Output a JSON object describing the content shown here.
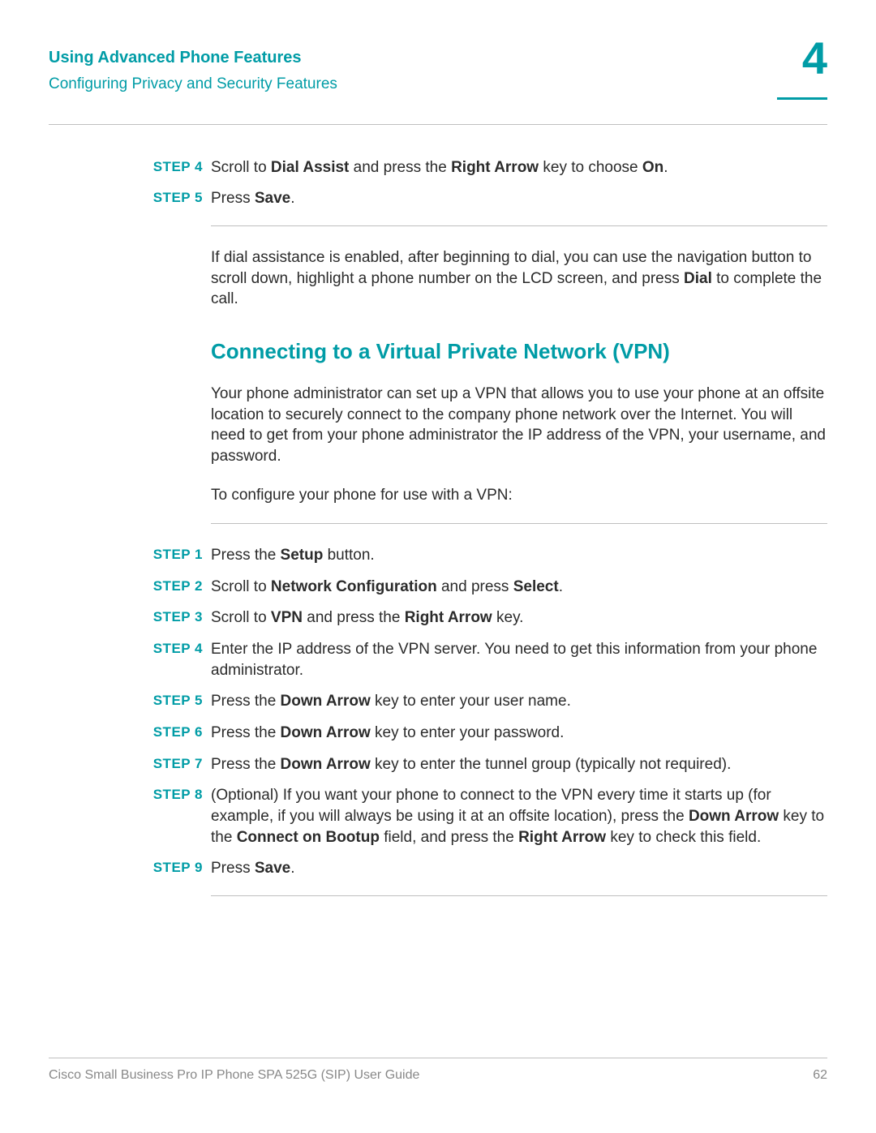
{
  "header": {
    "title": "Using Advanced Phone Features",
    "subtitle": "Configuring Privacy and Security Features",
    "chapter": "4"
  },
  "stepsA": [
    {
      "label": "STEP 4",
      "parts": [
        "Scroll to ",
        "Dial Assist",
        " and press the ",
        "Right Arrow",
        " key to choose ",
        "On",
        "."
      ]
    },
    {
      "label": "STEP 5",
      "parts": [
        "Press ",
        "Save",
        "."
      ]
    }
  ],
  "note": {
    "parts": [
      "If dial assistance is enabled, after beginning to dial, you can use the navigation button to scroll down, highlight a phone number on the LCD screen, and press ",
      "Dial",
      " to complete the call."
    ]
  },
  "section": {
    "heading": "Connecting to a Virtual Private Network (VPN)",
    "intro1": "Your phone administrator can set up a VPN that allows you to use your phone at an offsite location to securely connect to the company phone network over the Internet. You will need to get from your phone administrator the IP address of the VPN, your username, and password.",
    "intro2": "To configure your phone for use with a VPN:"
  },
  "stepsB": [
    {
      "label": "STEP 1",
      "parts": [
        "Press the ",
        "Setup",
        " button."
      ]
    },
    {
      "label": "STEP 2",
      "parts": [
        "Scroll to ",
        "Network Configuration",
        " and press ",
        "Select",
        "."
      ]
    },
    {
      "label": "STEP 3",
      "parts": [
        "Scroll to ",
        "VPN",
        " and press the ",
        "Right Arrow",
        " key."
      ]
    },
    {
      "label": "STEP 4",
      "parts": [
        "Enter the IP address of the VPN server. You need to get this information from your phone administrator."
      ]
    },
    {
      "label": "STEP 5",
      "parts": [
        "Press the ",
        "Down Arrow",
        " key to enter your user name."
      ]
    },
    {
      "label": "STEP 6",
      "parts": [
        "Press the ",
        "Down Arrow",
        " key to enter your password."
      ]
    },
    {
      "label": "STEP 7",
      "parts": [
        "Press the ",
        "Down Arrow",
        " key to enter the tunnel group (typically not required)."
      ]
    },
    {
      "label": "STEP 8",
      "parts": [
        "(Optional) If you want your phone to connect to the VPN every time it starts up (for example, if you will always be using it at an offsite location), press the ",
        "Down Arrow",
        " key to the ",
        "Connect on Bootup",
        " field, and press the ",
        "Right Arrow",
        " key to check this field."
      ]
    },
    {
      "label": "STEP 9",
      "parts": [
        "Press ",
        "Save",
        "."
      ]
    }
  ],
  "footer": {
    "left": "Cisco Small Business Pro IP Phone SPA 525G (SIP) User Guide",
    "right": "62"
  }
}
